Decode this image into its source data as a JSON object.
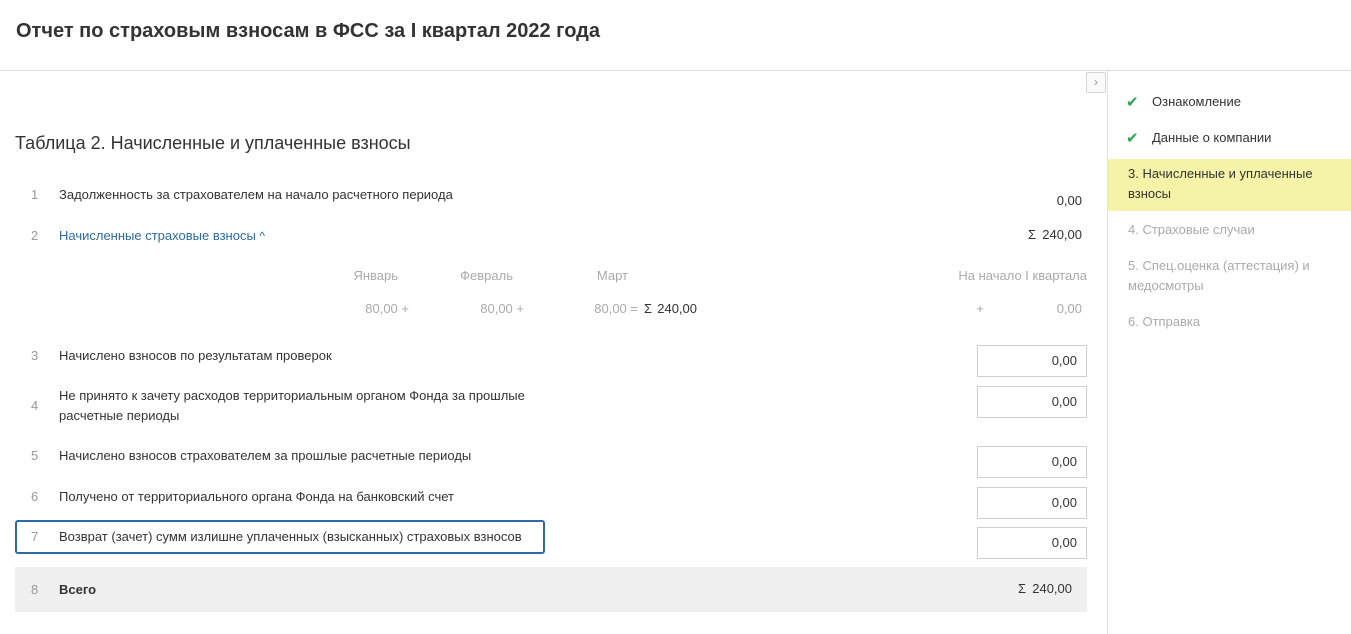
{
  "header": {
    "title": "Отчет по страховым взносам в ФСС за I квартал 2022 года"
  },
  "collapse_button": {
    "icon": "chevron-right-icon",
    "glyph": "›"
  },
  "sidebar": {
    "steps": [
      {
        "label": "Ознакомление",
        "state": "done"
      },
      {
        "label": "Данные о компании",
        "state": "done"
      },
      {
        "label": "3.  Начисленные и уплаченные",
        "label2": "взносы",
        "state": "active"
      },
      {
        "label": "4.  Страховые случаи",
        "state": "todo"
      },
      {
        "label": "5.  Спец.оценка (аттестация) и",
        "label2": "медосмотры",
        "state": "todo"
      },
      {
        "label": "6.  Отправка",
        "state": "todo"
      }
    ],
    "check_glyph": "✔"
  },
  "table": {
    "title": "Таблица 2. Начисленные и уплаченные взносы",
    "rows": [
      {
        "num": "1",
        "label": "Задолженность за страхователем на начало расчетного периода",
        "value": "0,00"
      },
      {
        "num": "2",
        "label": "Начисленные страховые взносы",
        "chevron": "^",
        "sigma": "Σ",
        "value": "240,00"
      },
      {
        "num": "3",
        "label": "Начислено взносов по результатам проверок",
        "value": "0,00"
      },
      {
        "num": "4",
        "label": "Не принято к зачету расходов территориальным органом Фонда за прошлые",
        "label2": "расчетные периоды",
        "value": "0,00"
      },
      {
        "num": "5",
        "label": "Начислено взносов страхователем за прошлые расчетные периоды",
        "value": "0,00"
      },
      {
        "num": "6",
        "label": "Получено от территориального органа Фонда на банковский счет",
        "value": "0,00"
      },
      {
        "num": "7",
        "label": "Возврат (зачет) сумм излишне уплаченных (взысканных) страховых взносов",
        "value": "0,00"
      },
      {
        "num": "8",
        "label": "Всего",
        "sigma": "Σ",
        "value": "240,00"
      }
    ],
    "breakdown": {
      "months": [
        "Январь",
        "Февраль",
        "Март"
      ],
      "start_label": "На начало I квартала",
      "jan": "80,00 +",
      "feb": "80,00 +",
      "mar": "80,00 =",
      "sigma": "Σ",
      "sum": "240,00",
      "plus": "+",
      "start_value": "0,00"
    }
  }
}
